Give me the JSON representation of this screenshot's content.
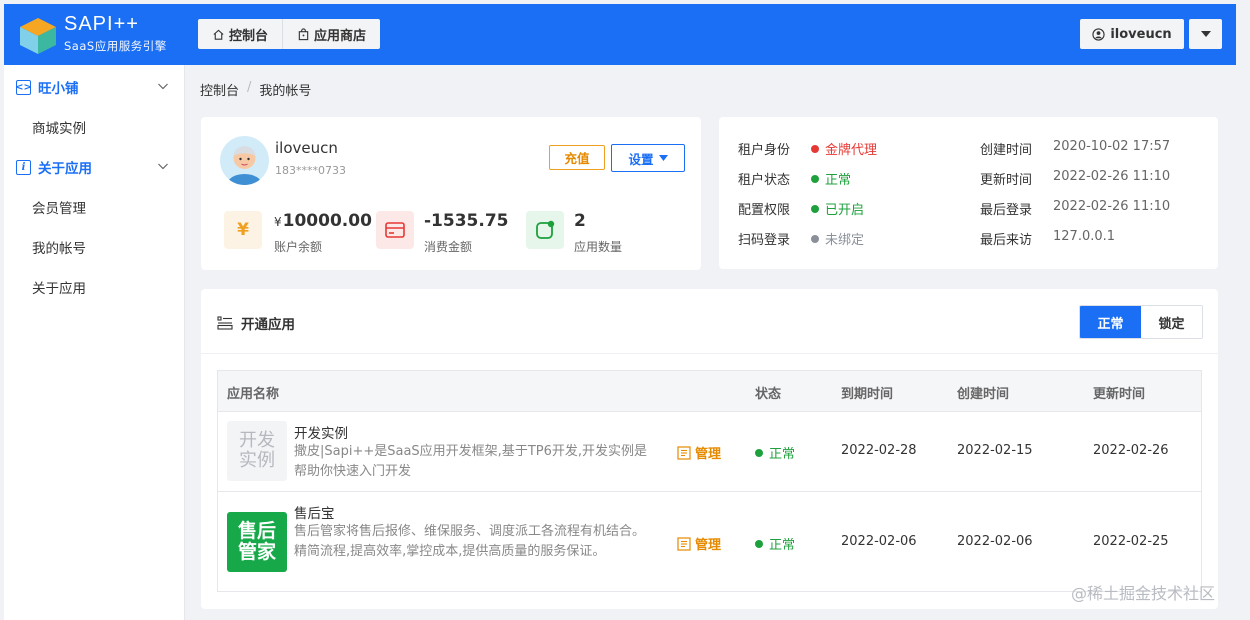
{
  "header": {
    "brand_title": "SAPI++",
    "brand_subtitle": "SaaS应用服务引擎",
    "tabs": [
      {
        "label": "控制台",
        "icon": "home-icon"
      },
      {
        "label": "应用商店",
        "icon": "store-icon"
      }
    ],
    "user": {
      "name": "iloveucn",
      "icon": "user-icon"
    }
  },
  "sidebar": {
    "groups": [
      {
        "label": "旺小铺",
        "icon": "code-icon",
        "items": [
          "商城实例"
        ]
      },
      {
        "label": "关于应用",
        "icon": "info-icon",
        "items": [
          "会员管理",
          "我的帐号",
          "关于应用"
        ]
      }
    ]
  },
  "breadcrumb": {
    "items": [
      "控制台",
      "我的帐号"
    ],
    "separator": "/"
  },
  "profile": {
    "username": "iloveucn",
    "phone": "183****0733",
    "recharge_label": "充值",
    "settings_label": "设置",
    "stats": [
      {
        "currency": "¥",
        "value": "10000.00",
        "label": "账户余额",
        "icon": "yen-icon"
      },
      {
        "currency": "",
        "value": "-1535.75",
        "label": "消费金额",
        "icon": "card-icon"
      },
      {
        "currency": "",
        "value": "2",
        "label": "应用数量",
        "icon": "app-count-icon"
      }
    ]
  },
  "info": {
    "left": [
      {
        "label": "租户身份",
        "value": "金牌代理",
        "color": "#e53935"
      },
      {
        "label": "租户状态",
        "value": "正常",
        "color": "#1ea03c"
      },
      {
        "label": "配置权限",
        "value": "已开启",
        "color": "#1ea03c"
      },
      {
        "label": "扫码登录",
        "value": "未绑定",
        "color": "#8a8f99"
      }
    ],
    "right": [
      {
        "label": "创建时间",
        "value": "2020-10-02 17:57"
      },
      {
        "label": "更新时间",
        "value": "2022-02-26 11:10"
      },
      {
        "label": "最后登录",
        "value": "2022-02-26 11:10"
      },
      {
        "label": "最后来访",
        "value": "127.0.0.1"
      }
    ]
  },
  "apps": {
    "title": "开通应用",
    "filters": [
      "正常",
      "锁定"
    ],
    "active_filter": "正常",
    "columns": [
      "应用名称",
      "状态",
      "到期时间",
      "创建时间",
      "更新时间"
    ],
    "rows": [
      {
        "logo_text": [
          "开发",
          "实例"
        ],
        "name": "开发实例",
        "desc": "撒皮|Sapi++是SaaS应用开发框架,基于TP6开发,开发实例是帮助你快速入门开发",
        "manage": "管理",
        "status": "正常",
        "expire": "2022-02-28",
        "created": "2022-02-15",
        "updated": "2022-02-26"
      },
      {
        "logo_text": [
          "售后",
          "管家"
        ],
        "name": "售后宝",
        "desc": "售后管家将售后报修、维保服务、调度派工各流程有机结合。精简流程,提高效率,掌控成本,提供高质量的服务保证。",
        "manage": "管理",
        "status": "正常",
        "expire": "2022-02-06",
        "created": "2022-02-06",
        "updated": "2022-02-25"
      }
    ]
  },
  "watermark": "@稀土掘金技术社区",
  "colors": {
    "primary": "#1b6ff5",
    "success": "#1ea03c",
    "warning": "#e68a00",
    "danger": "#e53935"
  }
}
